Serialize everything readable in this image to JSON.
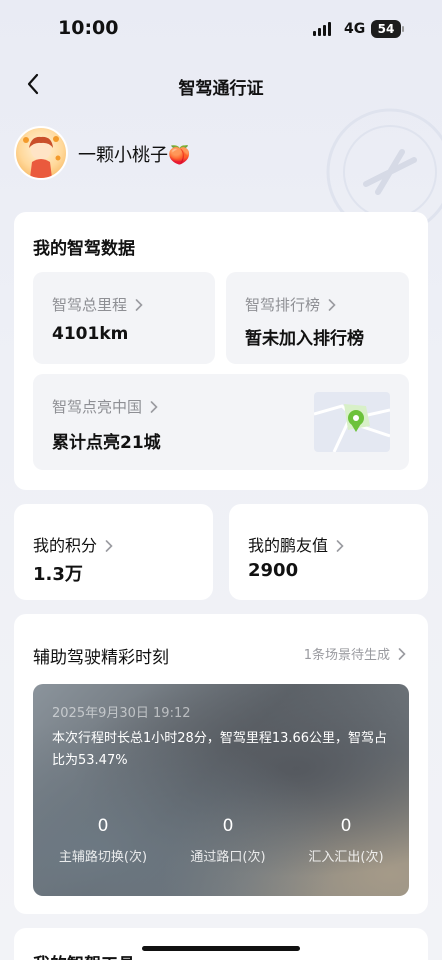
{
  "status_bar": {
    "time": "10:00",
    "network": "4G",
    "battery": "54"
  },
  "nav": {
    "title": "智驾通行证"
  },
  "profile": {
    "nickname": "一颗小桃子🍑"
  },
  "driving_data": {
    "title": "我的智驾数据",
    "total_mileage": {
      "label": "智驾总里程",
      "value": "4101km"
    },
    "ranking": {
      "label": "智驾排行榜",
      "value": "暂未加入排行榜"
    },
    "china_map": {
      "label": "智驾点亮中国",
      "value": "累计点亮21城"
    }
  },
  "points": {
    "label": "我的积分",
    "value": "1.3万"
  },
  "friend_value": {
    "label": "我的鹏友值",
    "value": "2900"
  },
  "highlights": {
    "title": "辅助驾驶精彩时刻",
    "link": "1条场景待生成",
    "trip": {
      "date": "2025年9月30日 19:12",
      "summary": "本次行程时长总1小时28分，智驾里程13.66公里，智驾占比为53.47%",
      "stats": [
        {
          "value": "0",
          "label": "主辅路切换(次)"
        },
        {
          "value": "0",
          "label": "通过路口(次)"
        },
        {
          "value": "0",
          "label": "汇入汇出(次)"
        }
      ]
    }
  },
  "tools": {
    "title": "我的智驾工具"
  },
  "colors": {
    "accent_green": "#6cc23a",
    "map_green": "#d8f0c8",
    "tile_bg": "#f3f4f7"
  }
}
